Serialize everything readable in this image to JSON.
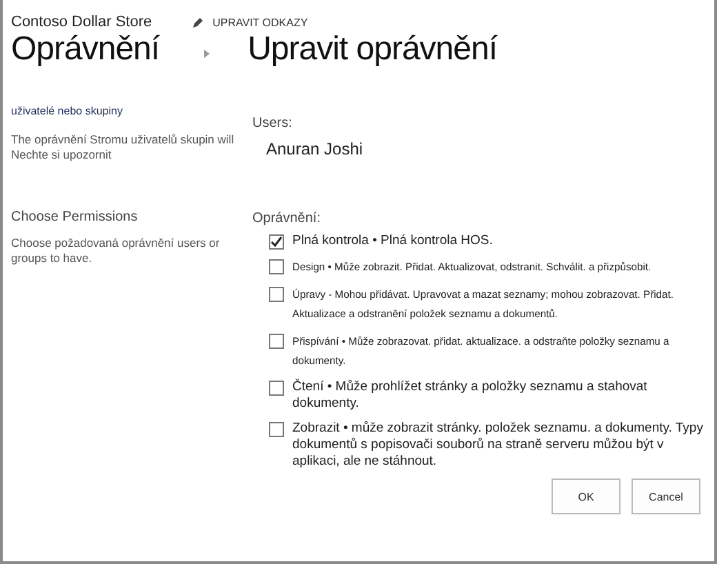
{
  "site_title": "Contoso Dollar Store",
  "edit_links": "UPRAVIT ODKAZY",
  "breadcrumb": [
    "Oprávnění",
    "Upravit oprávnění"
  ],
  "sections": [
    {
      "heading": "uživatelé nebo skupiny",
      "description": "The oprávnění Stromu uživatelů skupin will Nechte si upozornit"
    },
    {
      "heading": "Choose Permissions",
      "description": "Choose požadovaná oprávnění users or groups to have."
    }
  ],
  "users": {
    "label": "Users:",
    "value": "Anuran Joshi"
  },
  "permissions": {
    "label": "Oprávnění:",
    "items": [
      {
        "text": "Plná kontrola • Plná kontrola HOS.",
        "checked": true
      },
      {
        "text": "Design • Může zobrazit. Přidat. Aktualizovat, odstranit. Schválit. a přizpůsobit.",
        "checked": false
      },
      {
        "text": "Úpravy - Mohou přidávat. Upravovat a mazat seznamy; mohou zobrazovat. Přidat. Aktualizace a odstranění položek seznamu a dokumentů.",
        "checked": false
      },
      {
        "text": "Přispívání • Může zobrazovat. přidat. aktualizace. a odstraňte položky seznamu a dokumenty.",
        "checked": false
      },
      {
        "text": "Čtení • Může prohlížet stránky a položky seznamu a stahovat dokumenty.",
        "checked": false
      },
      {
        "text": "Zobrazit • může zobrazit stránky. položek seznamu. a dokumenty. Typy dokumentů s popisovači souborů na straně serveru můžou být v aplikaci, ale ne stáhnout.",
        "checked": false
      }
    ]
  },
  "buttons": [
    "OK",
    "Cancel"
  ]
}
